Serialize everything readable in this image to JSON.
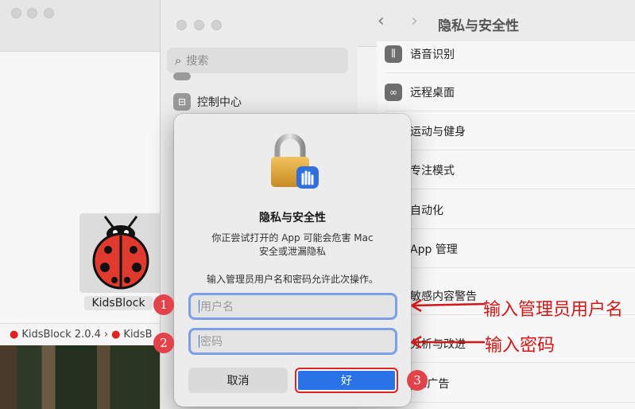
{
  "finder": {
    "app_name": "KidsBlock",
    "path": {
      "item1": "KidsBlock 2.0.4",
      "separator": "›",
      "item2": "KidsB"
    }
  },
  "settings": {
    "search_placeholder": "搜索",
    "sidebar": [
      {
        "label": "控制中心",
        "icon": "control-center-icon"
      }
    ],
    "title": "隐私与安全性",
    "back": "‹",
    "forward": "›",
    "rows": [
      {
        "label": "语音识别",
        "icon": "waveform-icon"
      },
      {
        "label": "远程桌面",
        "icon": "binoculars-icon"
      },
      {
        "label": "运动与健身",
        "icon": "fitness-icon"
      },
      {
        "label": "专注模式",
        "icon": "moon-icon"
      },
      {
        "label": "自动化",
        "icon": "gear-icon"
      },
      {
        "label": "App 管理",
        "icon": "app-icon"
      },
      {
        "label": "敏感内容警告",
        "icon": "eye-icon"
      },
      {
        "label": "分析与改进",
        "icon": "chart-icon"
      },
      {
        "label": "ple广告",
        "icon": "megaphone-icon"
      }
    ]
  },
  "dialog": {
    "title": "隐私与安全性",
    "message_line1": "你正尝试打开的 App 可能会危害 Mac",
    "message_line2": "安全或泄漏隐私",
    "prompt": "输入管理员用户名和密码允许此次操作。",
    "username_placeholder": "用户名",
    "password_placeholder": "密码",
    "cancel": "取消",
    "ok": "好"
  },
  "annotations": {
    "badge1": "1",
    "badge2": "2",
    "badge3": "3",
    "label_username": "输入管理员用户名",
    "label_password": "输入密码",
    "color": "#d01818"
  }
}
